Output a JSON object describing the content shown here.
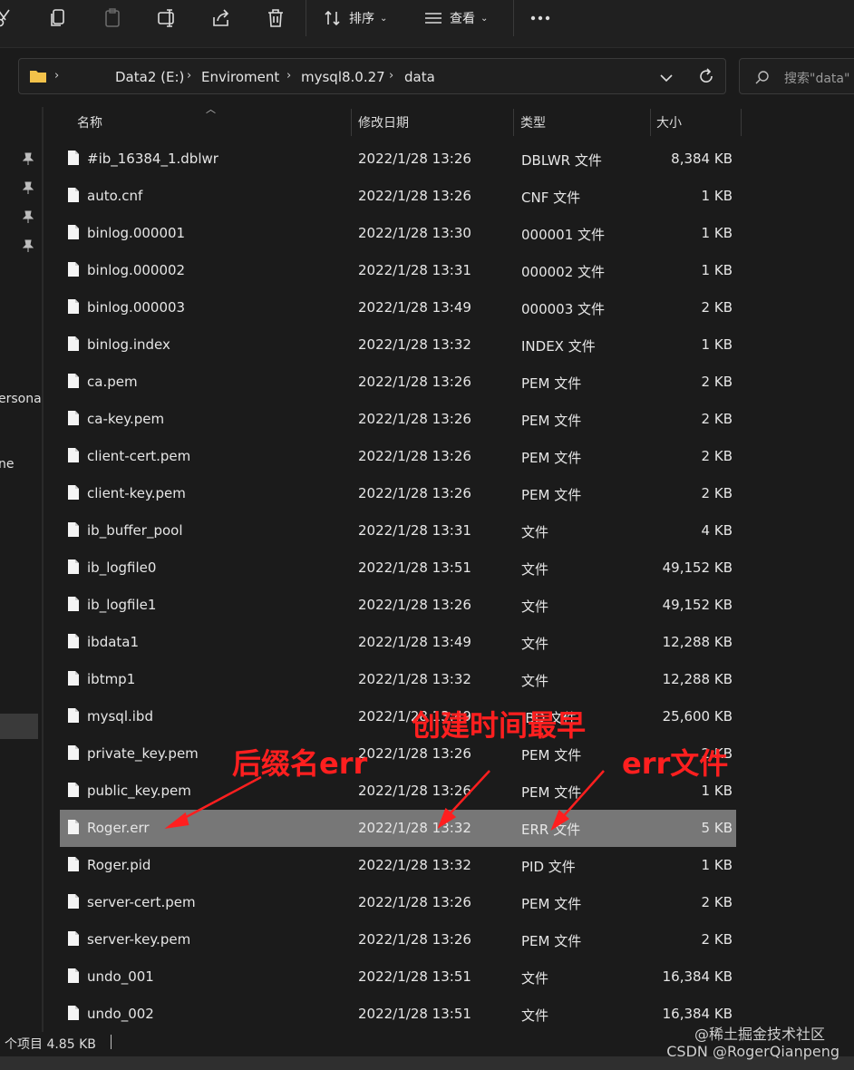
{
  "toolbar": {
    "sort_label": "排序",
    "view_label": "查看"
  },
  "address_bar": {
    "chevron": "›",
    "segments": [
      "Data2 (E:)",
      "Enviroment",
      "mysql8.0.27",
      "data"
    ]
  },
  "search": {
    "placeholder": "搜索\"data\""
  },
  "nav_fragments": {
    "personal": "ersona",
    "home": "ne"
  },
  "columns": {
    "name": "名称",
    "date": "修改日期",
    "type": "类型",
    "size": "大小"
  },
  "files": [
    {
      "name": "#ib_16384_1.dblwr",
      "date": "2022/1/28 13:26",
      "type": "DBLWR 文件",
      "size": "8,384 KB"
    },
    {
      "name": "auto.cnf",
      "date": "2022/1/28 13:26",
      "type": "CNF 文件",
      "size": "1 KB"
    },
    {
      "name": "binlog.000001",
      "date": "2022/1/28 13:30",
      "type": "000001 文件",
      "size": "1 KB"
    },
    {
      "name": "binlog.000002",
      "date": "2022/1/28 13:31",
      "type": "000002 文件",
      "size": "1 KB"
    },
    {
      "name": "binlog.000003",
      "date": "2022/1/28 13:49",
      "type": "000003 文件",
      "size": "2 KB"
    },
    {
      "name": "binlog.index",
      "date": "2022/1/28 13:32",
      "type": "INDEX 文件",
      "size": "1 KB"
    },
    {
      "name": "ca.pem",
      "date": "2022/1/28 13:26",
      "type": "PEM 文件",
      "size": "2 KB"
    },
    {
      "name": "ca-key.pem",
      "date": "2022/1/28 13:26",
      "type": "PEM 文件",
      "size": "2 KB"
    },
    {
      "name": "client-cert.pem",
      "date": "2022/1/28 13:26",
      "type": "PEM 文件",
      "size": "2 KB"
    },
    {
      "name": "client-key.pem",
      "date": "2022/1/28 13:26",
      "type": "PEM 文件",
      "size": "2 KB"
    },
    {
      "name": "ib_buffer_pool",
      "date": "2022/1/28 13:31",
      "type": "文件",
      "size": "4 KB"
    },
    {
      "name": "ib_logfile0",
      "date": "2022/1/28 13:51",
      "type": "文件",
      "size": "49,152 KB"
    },
    {
      "name": "ib_logfile1",
      "date": "2022/1/28 13:26",
      "type": "文件",
      "size": "49,152 KB"
    },
    {
      "name": "ibdata1",
      "date": "2022/1/28 13:49",
      "type": "文件",
      "size": "12,288 KB"
    },
    {
      "name": "ibtmp1",
      "date": "2022/1/28 13:32",
      "type": "文件",
      "size": "12,288 KB"
    },
    {
      "name": "mysql.ibd",
      "date": "2022/1/28 13:49",
      "type": "IBD 文件",
      "size": "25,600 KB"
    },
    {
      "name": "private_key.pem",
      "date": "2022/1/28 13:26",
      "type": "PEM 文件",
      "size": "2 KB"
    },
    {
      "name": "public_key.pem",
      "date": "2022/1/28 13:26",
      "type": "PEM 文件",
      "size": "1 KB"
    },
    {
      "name": "Roger.err",
      "date": "2022/1/28 13:32",
      "type": "ERR 文件",
      "size": "5 KB",
      "selected": true
    },
    {
      "name": "Roger.pid",
      "date": "2022/1/28 13:32",
      "type": "PID 文件",
      "size": "1 KB"
    },
    {
      "name": "server-cert.pem",
      "date": "2022/1/28 13:26",
      "type": "PEM 文件",
      "size": "2 KB"
    },
    {
      "name": "server-key.pem",
      "date": "2022/1/28 13:26",
      "type": "PEM 文件",
      "size": "2 KB"
    },
    {
      "name": "undo_001",
      "date": "2022/1/28 13:51",
      "type": "文件",
      "size": "16,384 KB"
    },
    {
      "name": "undo_002",
      "date": "2022/1/28 13:51",
      "type": "文件",
      "size": "16,384 KB"
    }
  ],
  "status": {
    "text": "个项目  4.85 KB"
  },
  "annotations": {
    "suffix": "后缀名err",
    "earliest": "创建时间最早",
    "errfile": "err文件",
    "color": "#ff1f1f"
  },
  "watermark": {
    "line1": "@稀土掘金技术社区",
    "line2": "CSDN @RogerQianpeng"
  },
  "colors": {
    "background": "#1b1b1b",
    "selected_row": "#777777"
  }
}
